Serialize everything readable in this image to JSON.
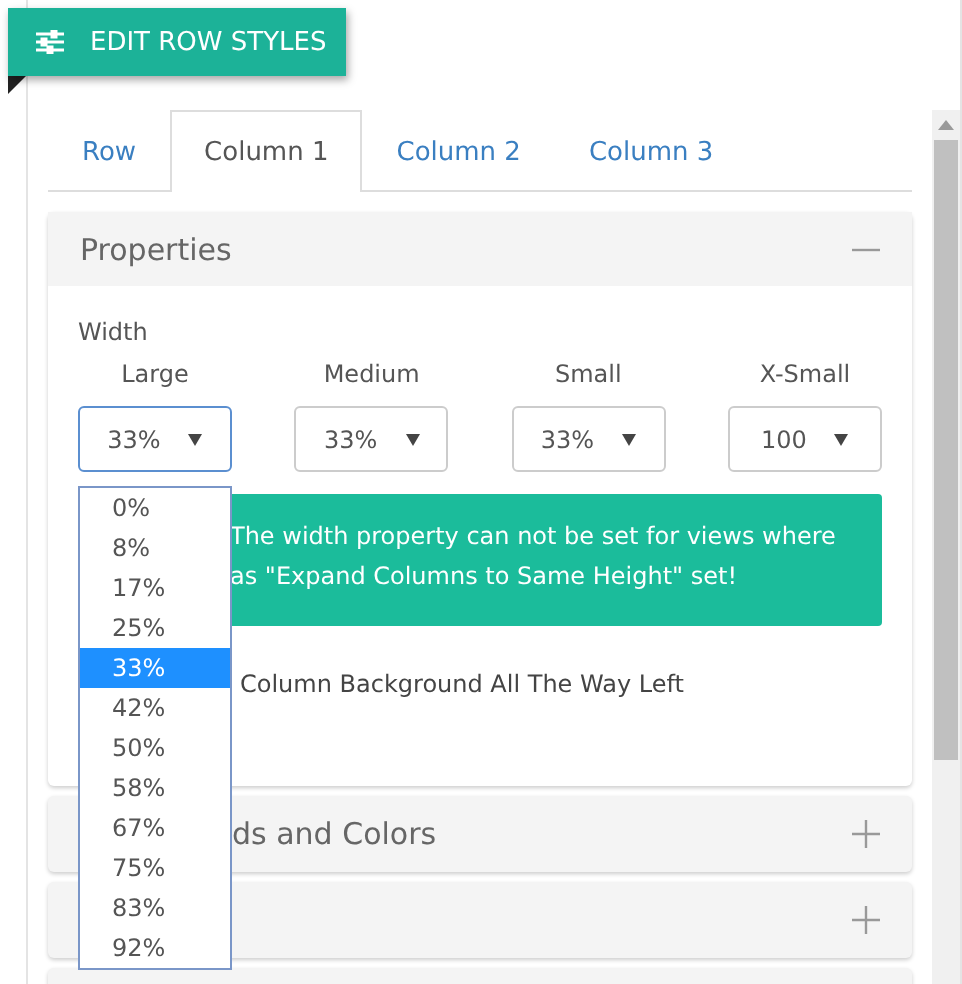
{
  "header_button": {
    "label": "EDIT ROW STYLES"
  },
  "tabs": [
    {
      "label": "Row",
      "selected": false
    },
    {
      "label": "Column 1",
      "selected": true
    },
    {
      "label": "Column 2",
      "selected": false
    },
    {
      "label": "Column 3",
      "selected": false
    }
  ],
  "properties": {
    "title": "Properties",
    "expanded": true,
    "width_label": "Width",
    "sizes": [
      {
        "label": "Large",
        "value": "33%",
        "focused": true
      },
      {
        "label": "Medium",
        "value": "33%",
        "focused": false
      },
      {
        "label": "Small",
        "value": "33%",
        "focused": false
      },
      {
        "label": "X-Small",
        "value": "100",
        "focused": false
      }
    ],
    "dropdown_options": [
      {
        "label": "0%",
        "selected": false
      },
      {
        "label": "8%",
        "selected": false
      },
      {
        "label": "17%",
        "selected": false
      },
      {
        "label": "25%",
        "selected": false
      },
      {
        "label": "33%",
        "selected": true
      },
      {
        "label": "42%",
        "selected": false
      },
      {
        "label": "50%",
        "selected": false
      },
      {
        "label": "58%",
        "selected": false
      },
      {
        "label": "67%",
        "selected": false
      },
      {
        "label": "75%",
        "selected": false
      },
      {
        "label": "83%",
        "selected": false
      },
      {
        "label": "92%",
        "selected": false
      }
    ],
    "alert": "The width property can not be set for views where as \"Expand Columns to Same Height\" set!",
    "option_label": "Column Background All The Way Left"
  },
  "collapsed_panels": [
    {
      "title": "ds and Colors",
      "expanded": false
    },
    {
      "expanded": false
    }
  ]
}
